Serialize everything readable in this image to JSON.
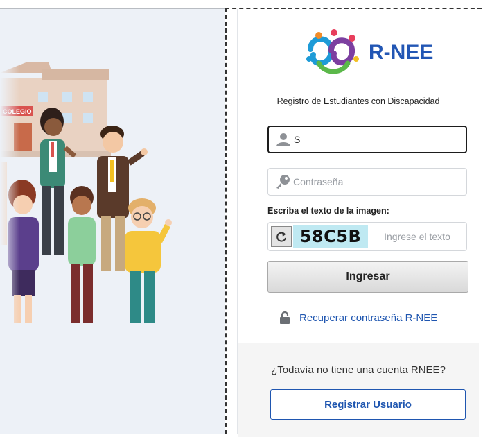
{
  "illustration": {
    "school_sign": "COLEGIO"
  },
  "brand": {
    "name": "R-NEE",
    "logo": "rnee-logo-icon"
  },
  "login": {
    "subtitle": "Registro de Estudiantes con Discapacidad",
    "username_value": "S",
    "username_icon": "user-icon",
    "password_placeholder": "Contraseña",
    "password_icon": "key-icon",
    "captcha_label": "Escriba el texto de la imagen:",
    "captcha_text": "58C5B",
    "captcha_refresh_icon": "refresh-icon",
    "captcha_placeholder": "Ingrese el texto",
    "submit_label": "Ingresar",
    "recover_label": "Recuperar contraseña R-NEE",
    "recover_icon": "lock-icon"
  },
  "register": {
    "prompt": "¿Todavía no tiene una cuenta RNEE?",
    "button_label": "Registrar Usuario"
  },
  "colors": {
    "brand_blue": "#2256b4",
    "panel_bg": "#edf1f7",
    "captcha_bg": "#bfe9f2"
  }
}
